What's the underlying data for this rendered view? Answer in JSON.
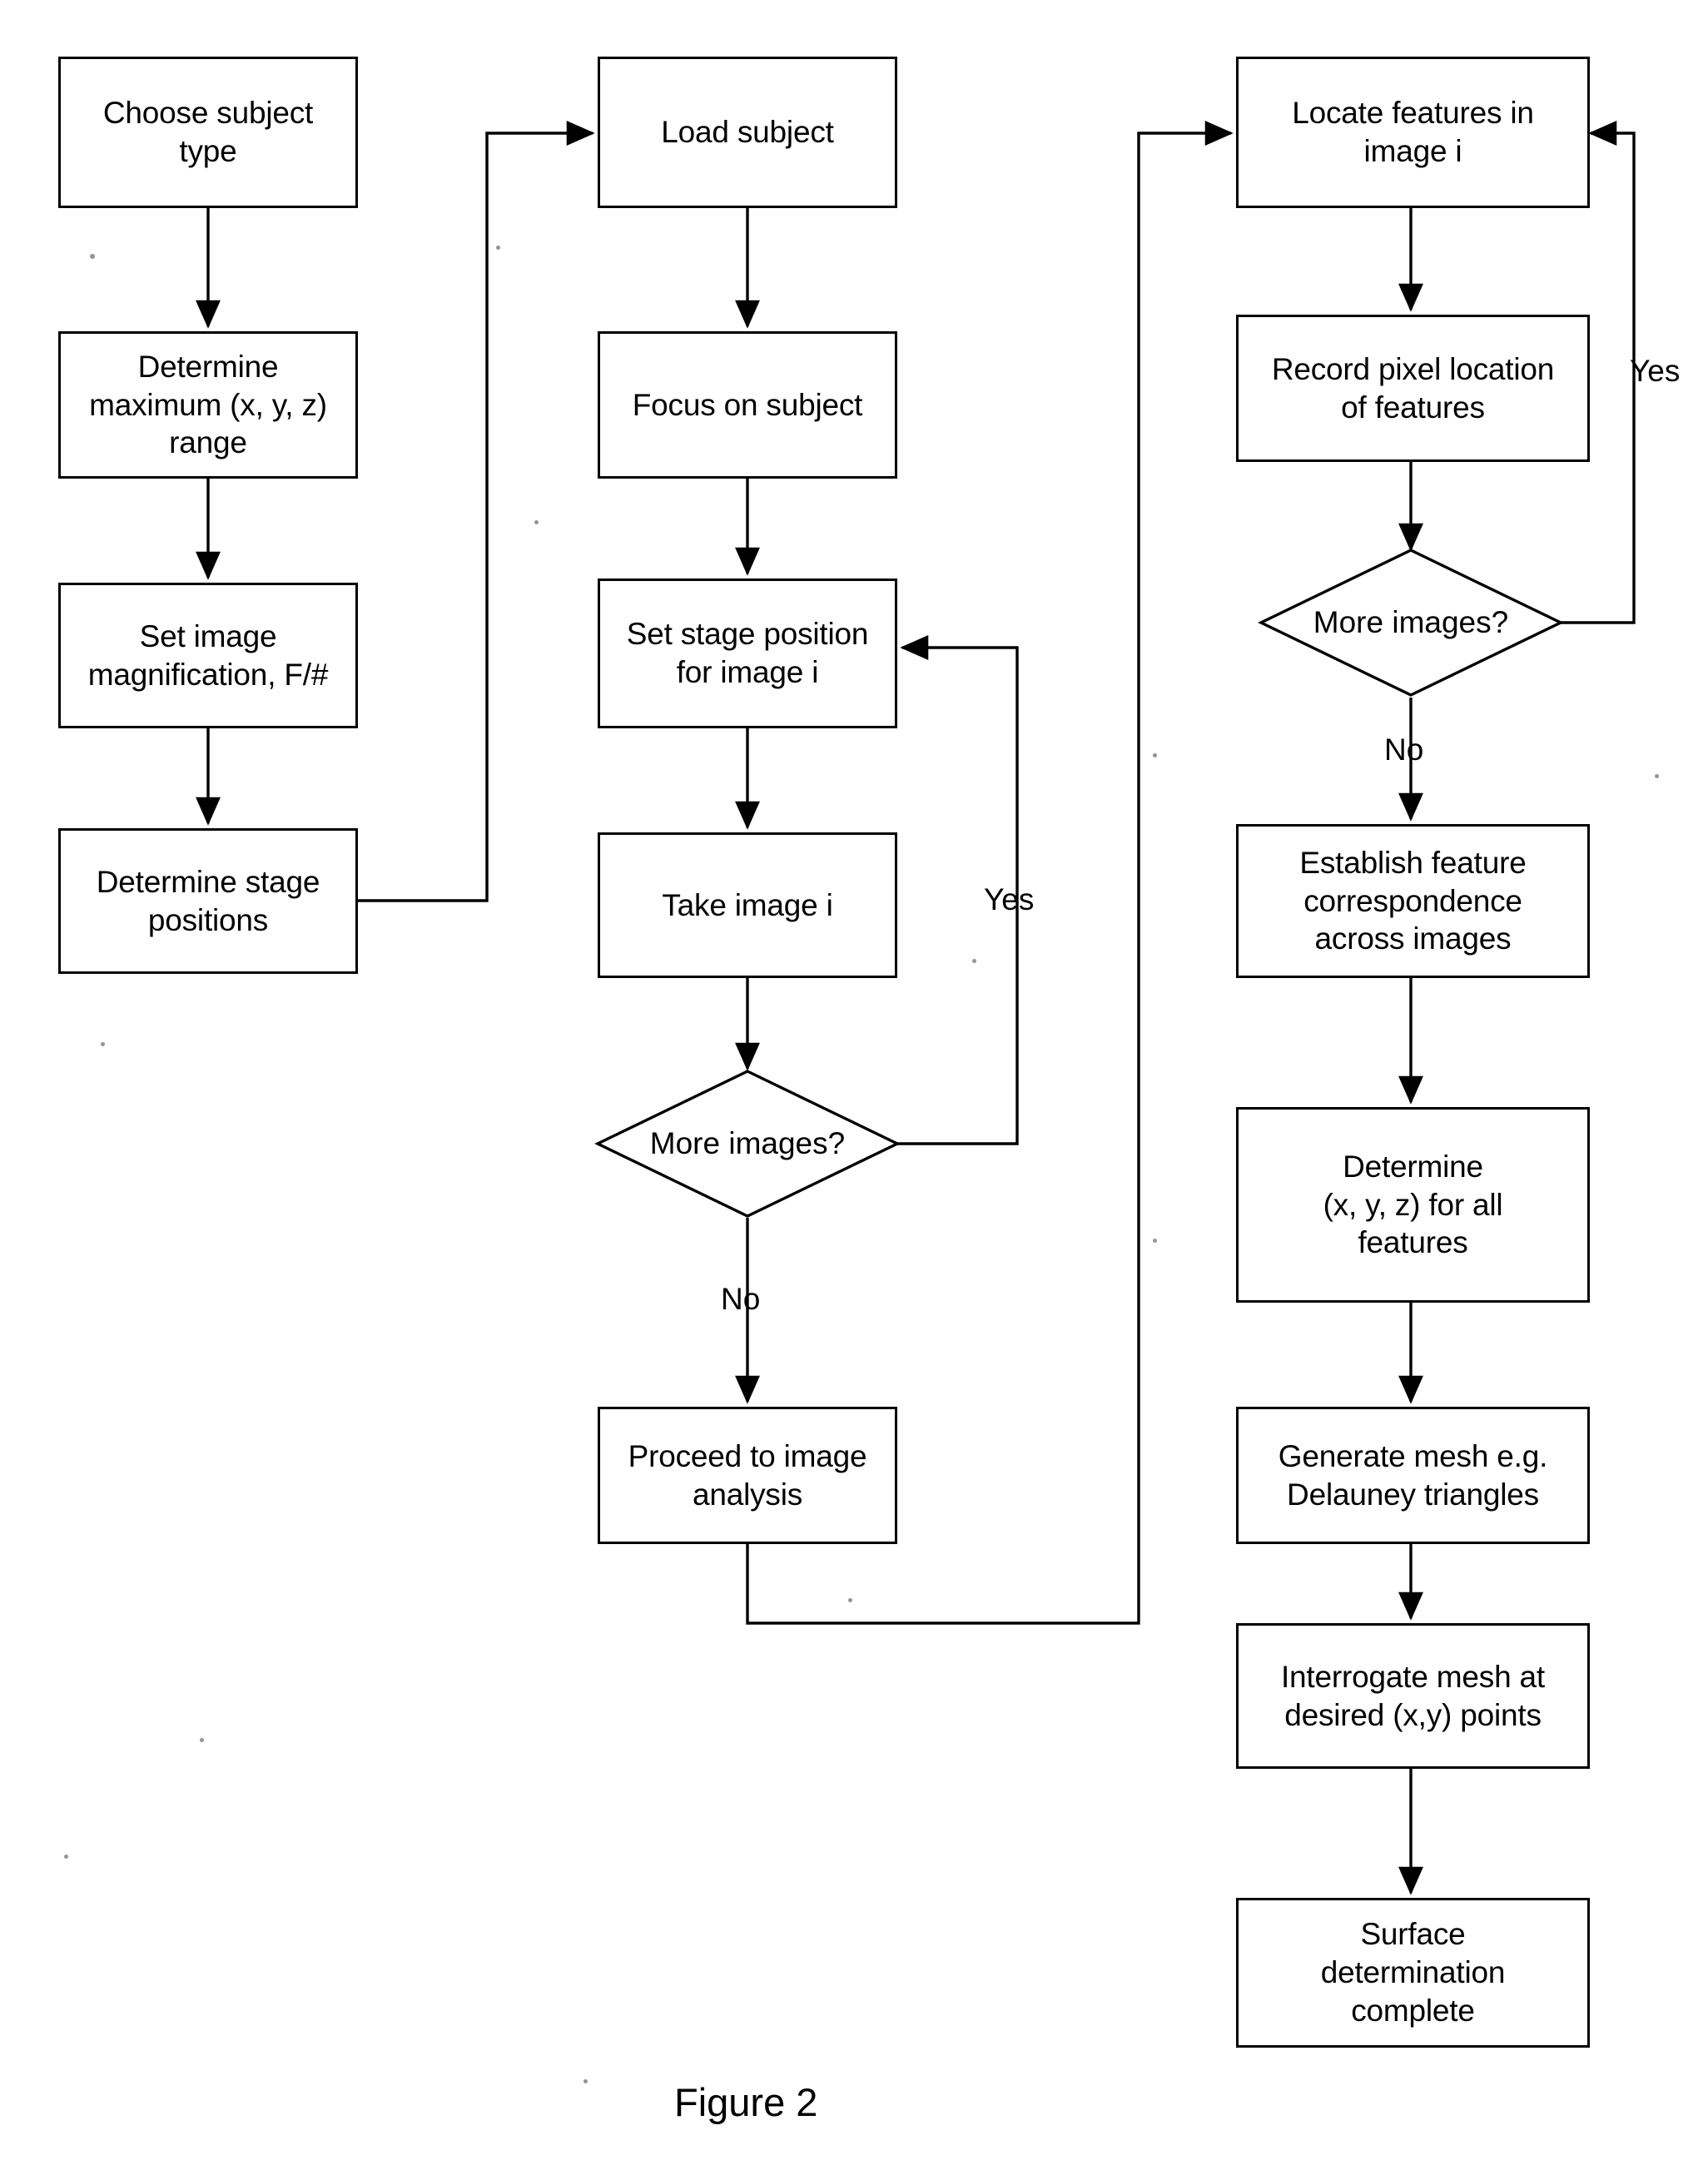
{
  "figure": {
    "caption": "Figure 2"
  },
  "columns": [
    {
      "name": "setup-column",
      "nodes": [
        {
          "id": "choose-subject-type",
          "label": "Choose subject\ntype",
          "shape": "process"
        },
        {
          "id": "determine-max-range",
          "label": "Determine\nmaximum (x, y, z)\nrange",
          "shape": "process"
        },
        {
          "id": "set-image-magnification",
          "label": "Set image\nmagnification, F/#",
          "shape": "process"
        },
        {
          "id": "determine-stage-positions",
          "label": "Determine stage\npositions",
          "shape": "process"
        }
      ]
    },
    {
      "name": "acquisition-column",
      "nodes": [
        {
          "id": "load-subject",
          "label": "Load subject",
          "shape": "process"
        },
        {
          "id": "focus-on-subject",
          "label": "Focus on subject",
          "shape": "process"
        },
        {
          "id": "set-stage-position",
          "label": "Set stage position\nfor image i",
          "shape": "process"
        },
        {
          "id": "take-image",
          "label": "Take image i",
          "shape": "process"
        },
        {
          "id": "more-images-acquisition",
          "label": "More images?",
          "shape": "decision"
        },
        {
          "id": "proceed-to-image-analysis",
          "label": "Proceed to image\nanalysis",
          "shape": "process"
        }
      ]
    },
    {
      "name": "analysis-column",
      "nodes": [
        {
          "id": "locate-features",
          "label": "Locate features in\nimage i",
          "shape": "process"
        },
        {
          "id": "record-pixel-location",
          "label": "Record pixel location\nof features",
          "shape": "process"
        },
        {
          "id": "more-images-analysis",
          "label": "More images?",
          "shape": "decision"
        },
        {
          "id": "establish-correspondence",
          "label": "Establish feature\ncorrespondence\nacross images",
          "shape": "process"
        },
        {
          "id": "determine-xyz",
          "label": "Determine\n(x, y, z) for all\nfeatures",
          "shape": "process"
        },
        {
          "id": "generate-mesh",
          "label": "Generate mesh e.g.\nDelauney triangles",
          "shape": "process"
        },
        {
          "id": "interrogate-mesh",
          "label": "Interrogate mesh at\ndesired (x,y) points",
          "shape": "process"
        },
        {
          "id": "surface-complete",
          "label": "Surface\ndetermination\ncomplete",
          "shape": "process"
        }
      ]
    }
  ],
  "edge_labels": {
    "acquisition_loop_yes": "Yes",
    "acquisition_exit_no": "No",
    "analysis_loop_yes": "Yes",
    "analysis_exit_no": "No"
  },
  "style": {
    "stroke": "#000000",
    "fill": "#ffffff"
  },
  "chart_data": {
    "type": "diagram",
    "diagram_type": "flowchart",
    "title": "Figure 2",
    "nodes": [
      {
        "id": "choose-subject-type",
        "text": "Choose subject type",
        "shape": "process"
      },
      {
        "id": "determine-max-range",
        "text": "Determine maximum (x, y, z) range",
        "shape": "process"
      },
      {
        "id": "set-image-magnification",
        "text": "Set image magnification, F/#",
        "shape": "process"
      },
      {
        "id": "determine-stage-positions",
        "text": "Determine stage positions",
        "shape": "process"
      },
      {
        "id": "load-subject",
        "text": "Load subject",
        "shape": "process"
      },
      {
        "id": "focus-on-subject",
        "text": "Focus on subject",
        "shape": "process"
      },
      {
        "id": "set-stage-position",
        "text": "Set stage position for image i",
        "shape": "process"
      },
      {
        "id": "take-image",
        "text": "Take image i",
        "shape": "process"
      },
      {
        "id": "more-images-acquisition",
        "text": "More images?",
        "shape": "decision"
      },
      {
        "id": "proceed-to-image-analysis",
        "text": "Proceed to image analysis",
        "shape": "process"
      },
      {
        "id": "locate-features",
        "text": "Locate features in image i",
        "shape": "process"
      },
      {
        "id": "record-pixel-location",
        "text": "Record pixel location of features",
        "shape": "process"
      },
      {
        "id": "more-images-analysis",
        "text": "More images?",
        "shape": "decision"
      },
      {
        "id": "establish-correspondence",
        "text": "Establish feature correspondence across images",
        "shape": "process"
      },
      {
        "id": "determine-xyz",
        "text": "Determine (x, y, z) for all features",
        "shape": "process"
      },
      {
        "id": "generate-mesh",
        "text": "Generate mesh e.g. Delauney triangles",
        "shape": "process"
      },
      {
        "id": "interrogate-mesh",
        "text": "Interrogate mesh at desired (x,y) points",
        "shape": "process"
      },
      {
        "id": "surface-complete",
        "text": "Surface determination complete",
        "shape": "process"
      }
    ],
    "edges": [
      {
        "from": "choose-subject-type",
        "to": "determine-max-range",
        "label": ""
      },
      {
        "from": "determine-max-range",
        "to": "set-image-magnification",
        "label": ""
      },
      {
        "from": "set-image-magnification",
        "to": "determine-stage-positions",
        "label": ""
      },
      {
        "from": "determine-stage-positions",
        "to": "load-subject",
        "label": ""
      },
      {
        "from": "load-subject",
        "to": "focus-on-subject",
        "label": ""
      },
      {
        "from": "focus-on-subject",
        "to": "set-stage-position",
        "label": ""
      },
      {
        "from": "set-stage-position",
        "to": "take-image",
        "label": ""
      },
      {
        "from": "take-image",
        "to": "more-images-acquisition",
        "label": ""
      },
      {
        "from": "more-images-acquisition",
        "to": "set-stage-position",
        "label": "Yes"
      },
      {
        "from": "more-images-acquisition",
        "to": "proceed-to-image-analysis",
        "label": "No"
      },
      {
        "from": "proceed-to-image-analysis",
        "to": "locate-features",
        "label": ""
      },
      {
        "from": "locate-features",
        "to": "record-pixel-location",
        "label": ""
      },
      {
        "from": "record-pixel-location",
        "to": "more-images-analysis",
        "label": ""
      },
      {
        "from": "more-images-analysis",
        "to": "locate-features",
        "label": "Yes"
      },
      {
        "from": "more-images-analysis",
        "to": "establish-correspondence",
        "label": "No"
      },
      {
        "from": "establish-correspondence",
        "to": "determine-xyz",
        "label": ""
      },
      {
        "from": "determine-xyz",
        "to": "generate-mesh",
        "label": ""
      },
      {
        "from": "generate-mesh",
        "to": "interrogate-mesh",
        "label": ""
      },
      {
        "from": "interrogate-mesh",
        "to": "surface-complete",
        "label": ""
      }
    ]
  }
}
